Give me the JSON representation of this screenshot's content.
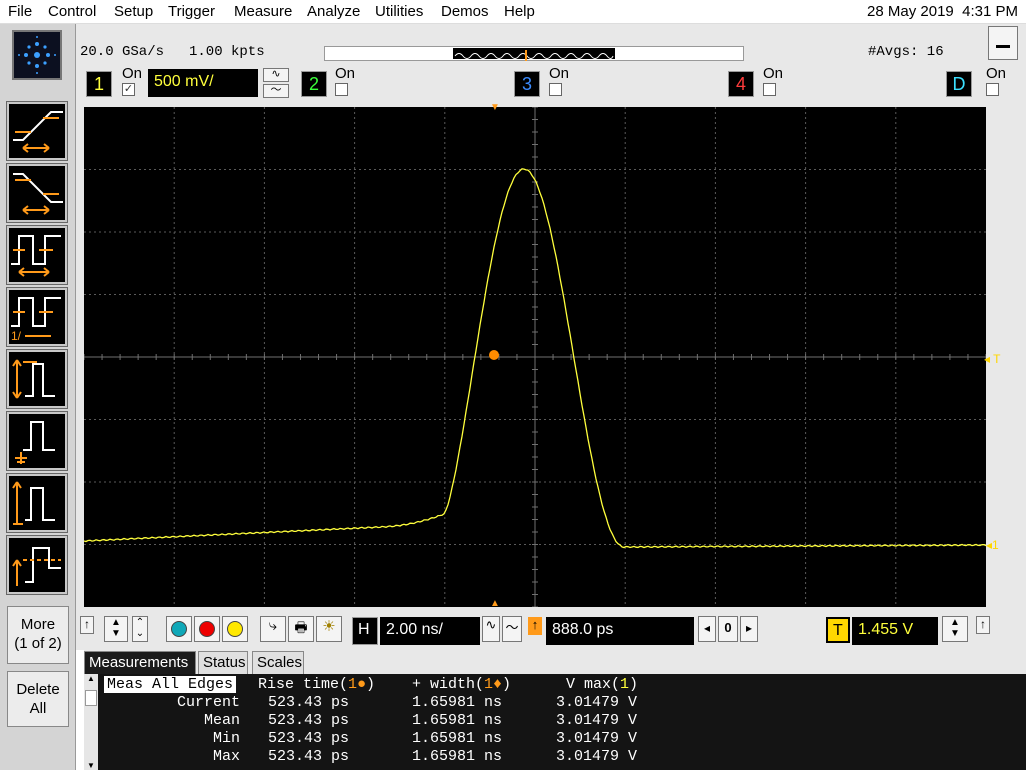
{
  "menubar": {
    "items": [
      "File",
      "Control",
      "Setup",
      "Trigger",
      "Measure",
      "Analyze",
      "Utilities",
      "Demos",
      "Help"
    ],
    "date": "28 May 2019",
    "time": "4:31 PM"
  },
  "acquisition": {
    "sample_rate": "20.0 GSa/s",
    "points": "1.00 kpts",
    "avgs": "#Avgs: 16"
  },
  "channels": [
    {
      "num": "1",
      "on_label": "On",
      "checked": true,
      "scale": "500 mV/",
      "color": "#ffff3c"
    },
    {
      "num": "2",
      "on_label": "On",
      "checked": false,
      "color": "#3cff3c"
    },
    {
      "num": "3",
      "on_label": "On",
      "checked": false,
      "color": "#3c8cff"
    },
    {
      "num": "4",
      "on_label": "On",
      "checked": false,
      "color": "#ff3c3c"
    },
    {
      "num": "D",
      "on_label": "On",
      "checked": false,
      "color": "#3ce0ff"
    }
  ],
  "sidebar": {
    "more_label": "More\n(1 of 2)",
    "delete_label": "Delete\nAll"
  },
  "screen": {
    "trigger_marker": "T",
    "ground_marker": "1"
  },
  "timebase": {
    "h_label": "H",
    "scale": "2.00 ns/",
    "delay": "888.0 ps",
    "delay_ref": "0",
    "t_label": "T",
    "trigger_level": "1.455 V"
  },
  "measurements": {
    "tabs": [
      "Measurements",
      "Status",
      "Scales"
    ],
    "meas_all_edges": "Meas All Edges",
    "headers": [
      {
        "pre": "Rise time(",
        "mark": "1●",
        "post": ")"
      },
      {
        "pre": "+ width(",
        "mark": "1♦",
        "post": ")"
      },
      {
        "pre": "V max(",
        "mark": "1",
        "post": ")"
      }
    ],
    "rows": [
      {
        "label": "Current",
        "rise": "523.43 ps",
        "width": "1.65981 ns",
        "vmax": "3.01479 V"
      },
      {
        "label": "Mean",
        "rise": "523.43 ps",
        "width": "1.65981 ns",
        "vmax": "3.01479 V"
      },
      {
        "label": "Min",
        "rise": "523.43 ps",
        "width": "1.65981 ns",
        "vmax": "3.01479 V"
      },
      {
        "label": "Max",
        "rise": "523.43 ps",
        "width": "1.65981 ns",
        "vmax": "3.01479 V"
      }
    ]
  },
  "waveform": {
    "color": "#ffff3c",
    "marker_color": "#ff8c00"
  }
}
